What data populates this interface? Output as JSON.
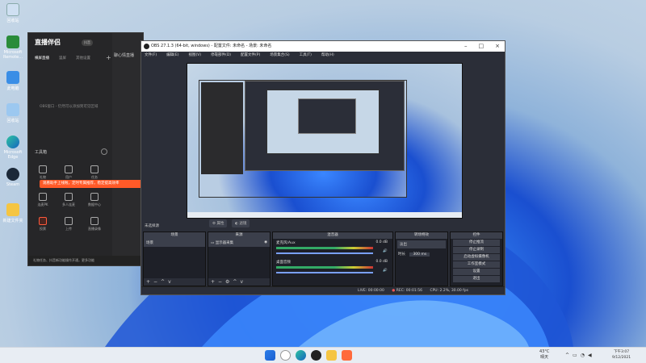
{
  "desktop": {
    "icons": [
      {
        "label": "回收站",
        "icon": "recycle-bin-icon"
      },
      {
        "label": "Microsoft Remote...",
        "icon": "remote-desktop-icon"
      },
      {
        "label": "此电脑",
        "icon": "this-pc-icon"
      },
      {
        "label": "回收站",
        "icon": "recycle-icon"
      },
      {
        "label": "Microsoft Edge",
        "icon": "edge-icon"
      },
      {
        "label": "Steam",
        "icon": "steam-icon"
      },
      {
        "label": "新建文件夹",
        "icon": "folder-icon"
      }
    ]
  },
  "live_app": {
    "logo": "直播伴侣",
    "version": "抖音",
    "tabs": [
      "横屏直播",
      "竖屏",
      "其他设置"
    ],
    "right_label": "聊心情直播",
    "empty_text": "OBS窗口 - 仍然可以添加到可见区域",
    "tools_title": "工具箱",
    "tools": [
      "礼物",
      "用户",
      "任务",
      "连麦PK",
      "多人连麦",
      "数据中心",
      "投票",
      "上传",
      "直播录像"
    ],
    "tip": "观看助手上线啦，定时专属推荐，稳定提高效率",
    "footer": "礼物任务、抖音新功能操作开通，更多功能"
  },
  "obs": {
    "title": "OBS 27.1.3 (64-bit, windows) - 配置文件: 未命名 - 场景: 未命名",
    "menu": [
      "文件(F)",
      "编辑(E)",
      "视图(V)",
      "停靠部件(D)",
      "配置文件(P)",
      "场景集合(S)",
      "工具(T)",
      "帮助(H)"
    ],
    "no_source": "未选择源",
    "props_label": "属性",
    "filters_label": "滤镜",
    "docks": {
      "scenes": {
        "title": "场景",
        "items": [
          "场景"
        ]
      },
      "sources": {
        "title": "来源",
        "items": [
          "显示器采集"
        ]
      },
      "mixer": {
        "title": "混音器",
        "channels": [
          {
            "name": "麦克风/Aux",
            "db": "0.0 dB"
          },
          {
            "name": "桌面音频",
            "db": "0.0 dB"
          }
        ]
      },
      "transitions": {
        "title": "转场特效",
        "type": "淡出",
        "duration_label": "时长",
        "duration": "300 ms"
      },
      "controls": {
        "title": "控件",
        "buttons": [
          "停止推流",
          "停止录制",
          "启动虚拟摄像机",
          "工作室模式",
          "设置",
          "退出"
        ]
      }
    },
    "status": {
      "live": "LIVE: 00:00:00",
      "rec": "REC: 00:01:56",
      "cpu": "CPU: 2.2%, 30.00 fps"
    }
  },
  "taskbar": {
    "icons": [
      "windows-start-icon",
      "search-icon",
      "edge-icon",
      "obs-icon",
      "explorer-icon",
      "live-app-icon"
    ],
    "weather": {
      "temp": "43°C",
      "desc": "晴天"
    },
    "clock": {
      "time": "下午3:07",
      "date": "9/12/2021"
    }
  }
}
